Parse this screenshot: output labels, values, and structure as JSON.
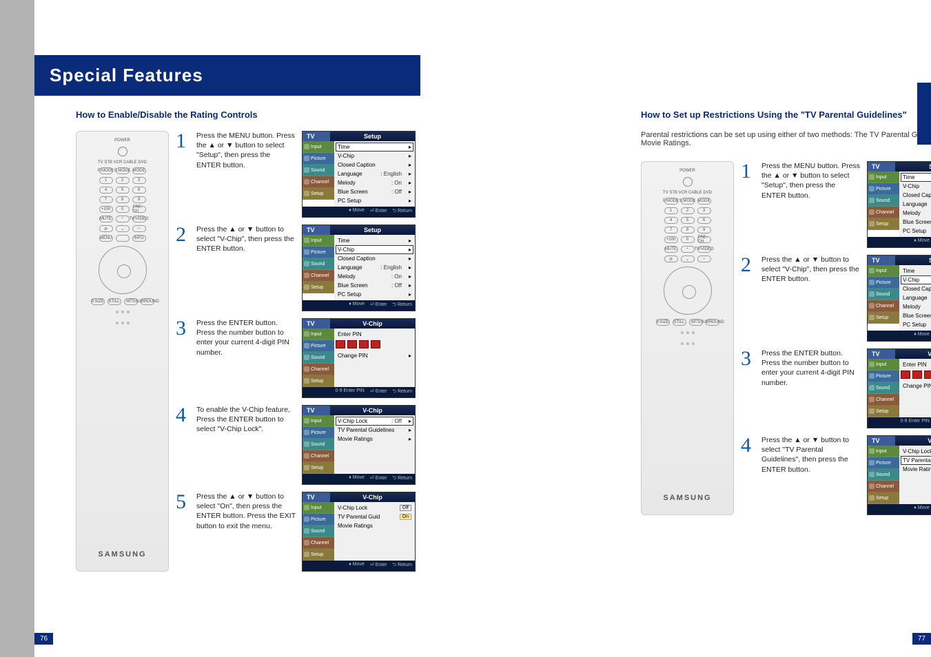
{
  "header": "Special Features",
  "page_left": "76",
  "page_right": "77",
  "remote": {
    "brand": "SAMSUNG",
    "source_row": "TV  STB  VCR  CABLE  DVD"
  },
  "left": {
    "subhead": "How to Enable/Disable the Rating Controls",
    "steps": [
      {
        "num": "1",
        "text": "Press the MENU button. Press the ▲ or ▼ button to select \"Setup\", then press the ENTER button."
      },
      {
        "num": "2",
        "text": "Press the ▲ or ▼ button to select \"V-Chip\", then press the ENTER button."
      },
      {
        "num": "3",
        "text": "Press the ENTER button. Press the number button to enter your current 4-digit PIN number."
      },
      {
        "num": "4",
        "text": "To enable the V-Chip feature, Press the ENTER button to select \"V-Chip Lock\"."
      },
      {
        "num": "5",
        "text": "Press the ▲ or ▼ button to select \"On\", then press the ENTER button. Press the EXIT button to exit the menu."
      }
    ]
  },
  "right": {
    "subhead": "How to Set up Restrictions Using the \"TV Parental Guidelines\"",
    "intro": "Parental restrictions can be set up using either of two methods: The TV Parental Guidelines or Movie Ratings.",
    "steps": [
      {
        "num": "1",
        "text": "Press the MENU button. Press the ▲ or ▼ button to select \"Setup\", then press the ENTER button."
      },
      {
        "num": "2",
        "text": "Press the ▲ or ▼ button to select \"V-Chip\", then press the ENTER button."
      },
      {
        "num": "3",
        "text": "Press the ENTER button. Press the number button to enter your current 4-digit PIN number."
      },
      {
        "num": "4",
        "text": "Press the ▲ or ▼ button to select \"TV Parental Guidelines\", then press the ENTER button."
      }
    ]
  },
  "osd": {
    "tv": "TV",
    "title_setup": "Setup",
    "title_vchip": "V-Chip",
    "tabs": {
      "input": "Input",
      "picture": "Picture",
      "sound": "Sound",
      "channel": "Channel",
      "setup": "Setup"
    },
    "setup_items": [
      {
        "label": "Time",
        "val": ""
      },
      {
        "label": "V-Chip",
        "val": ""
      },
      {
        "label": "Closed Caption",
        "val": ""
      },
      {
        "label": "Language",
        "val": ": English"
      },
      {
        "label": "Melody",
        "val": ": On"
      },
      {
        "label": "Blue Screen",
        "val": ": Off"
      },
      {
        "label": "PC Setup",
        "val": ""
      }
    ],
    "vchip_pin": {
      "label": "Enter PIN",
      "change": "Change PIN"
    },
    "vchip_items": [
      {
        "label": "V-Chip Lock",
        "val": ": Off"
      },
      {
        "label": "TV Parental Guidelines",
        "val": ""
      },
      {
        "label": "Movie Ratings",
        "val": ""
      }
    ],
    "vchip_items_on": [
      {
        "label": "V-Chip Lock",
        "val": ": On"
      },
      {
        "label": "TV Parental Guidelines",
        "val": ""
      },
      {
        "label": "Movie Ratings",
        "val": ""
      }
    ],
    "opt_off": "Off",
    "opt_on": "On",
    "footer_move": "Move",
    "footer_enter": "Enter",
    "footer_return": "Return",
    "footer_pin": "0-9 Enter PIN"
  }
}
